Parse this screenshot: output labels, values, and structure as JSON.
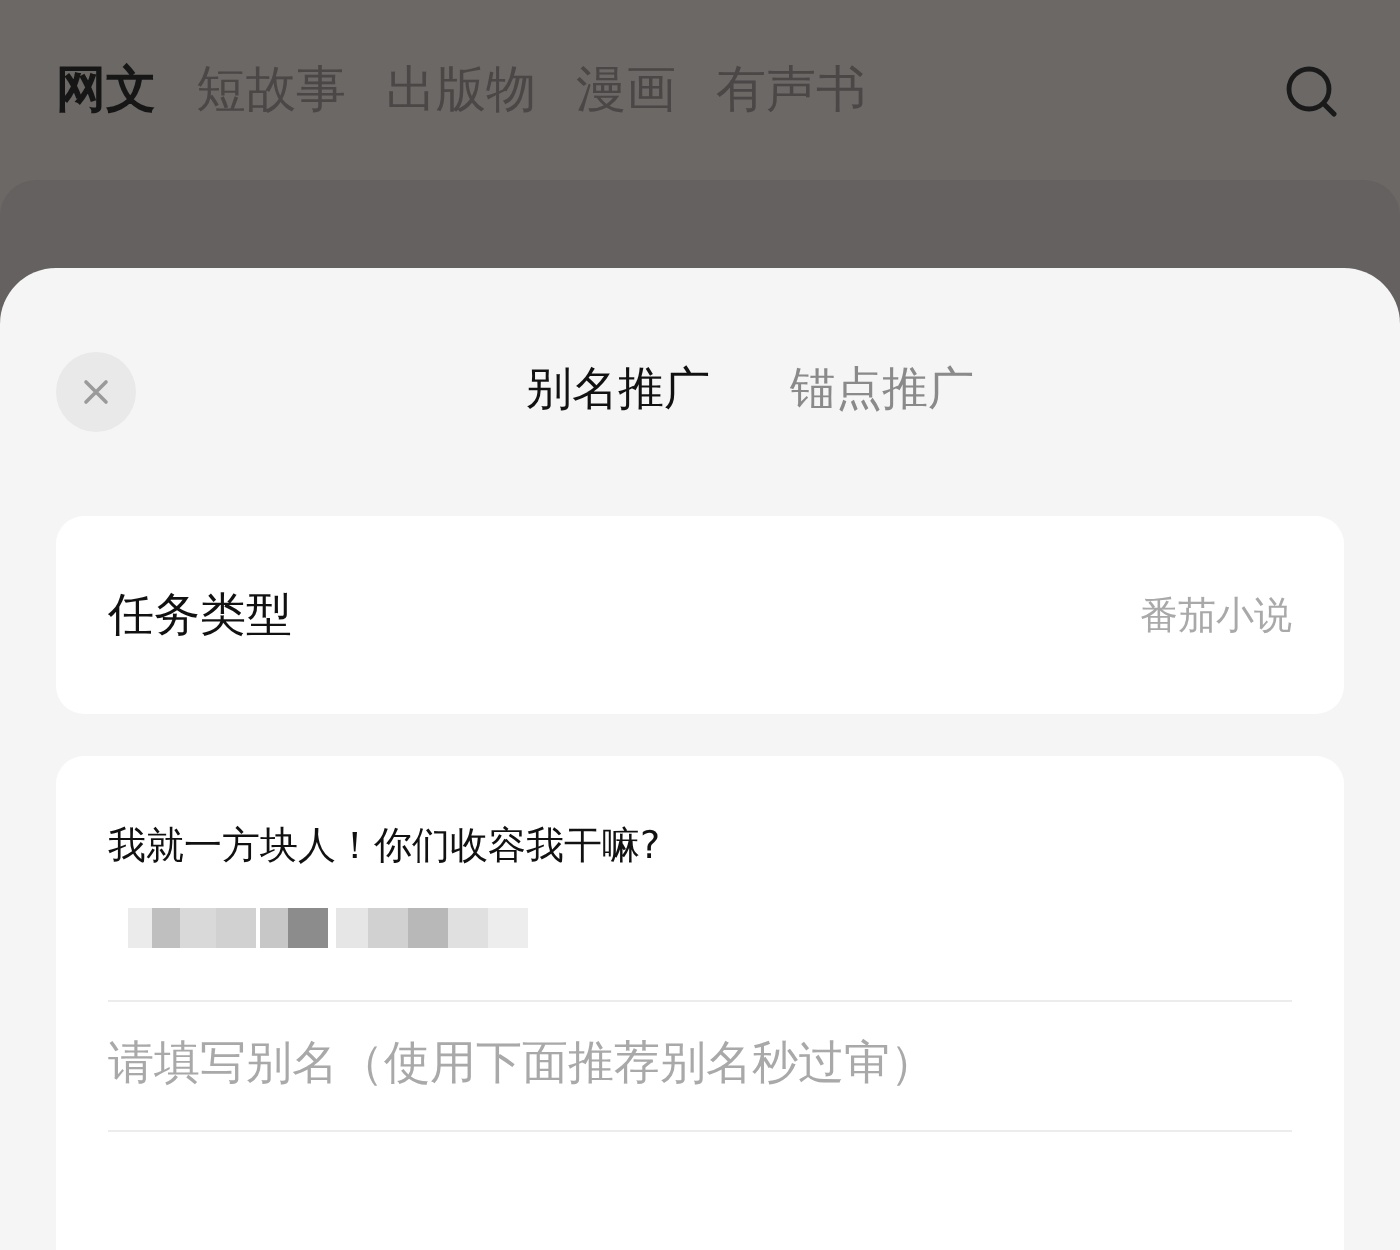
{
  "nav_tabs": [
    {
      "label": "网文",
      "selected": true
    },
    {
      "label": "短故事",
      "selected": false
    },
    {
      "label": "出版物",
      "selected": false
    },
    {
      "label": "漫画",
      "selected": false
    },
    {
      "label": "有声书",
      "selected": false
    }
  ],
  "sheet": {
    "tabs": [
      {
        "label": "别名推广",
        "selected": true
      },
      {
        "label": "锚点推广",
        "selected": false
      }
    ],
    "task_type": {
      "label": "任务类型",
      "value": "番茄小说"
    },
    "book": {
      "title": "我就一方块人！你们收容我干嘛?"
    },
    "alias_field": {
      "placeholder": "请填写别名（使用下面推荐别名秒过审）"
    }
  }
}
